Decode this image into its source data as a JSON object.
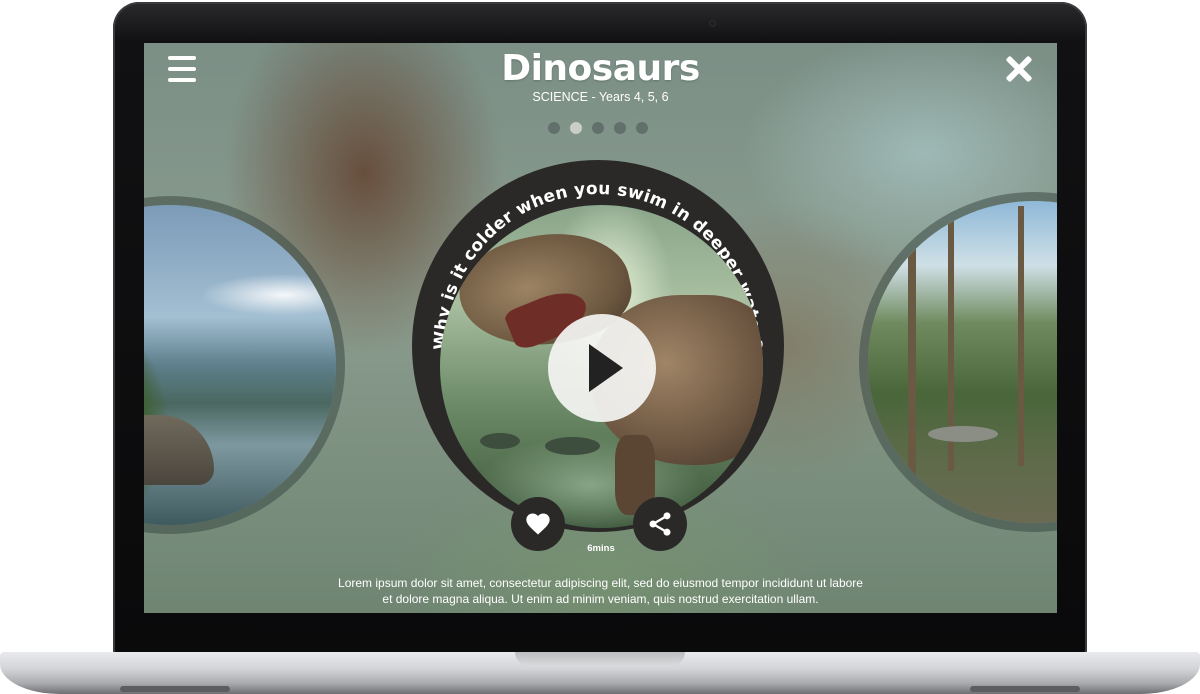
{
  "header": {
    "title": "Dinosaurs",
    "subtitle": "SCIENCE - Years 4, 5, 6",
    "menu_icon": "hamburger-menu-icon",
    "close_icon": "close-icon"
  },
  "pagination": {
    "count": 5,
    "active_index": 1
  },
  "video": {
    "question": "Why is it colder when you swim in deeper water?",
    "duration": "6mins",
    "play_icon": "play-icon",
    "like_icon": "heart-icon",
    "share_icon": "share-icon"
  },
  "description": "Lorem ipsum dolor sit amet, consectetur adipiscing elit, sed do eiusmod tempor incididunt ut labore et dolore magna aliqua. Ut enim ad minim veniam, quis nostrud exercitation ullam.",
  "colors": {
    "ring": "#2a2928",
    "text": "#ffffff",
    "play_button": "#f5f5f3"
  }
}
